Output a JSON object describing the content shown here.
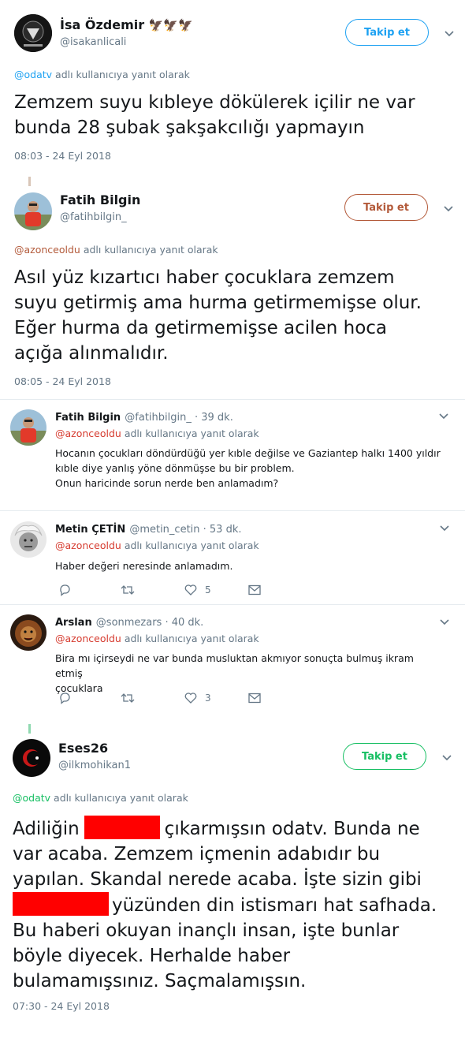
{
  "tweet1": {
    "name": "İsa Özdemir",
    "flags": "🦅🦅🦅",
    "handle": "@isakanlicali",
    "follow_label": "Takip et",
    "reply_to": "@odatv",
    "reply_suffix": "adlı kullanıcıya yanıt olarak",
    "text": "Zemzem suyu kıbleye dökülerek içilir ne var bunda 28 şubak şakşakcılığı yapmayın",
    "time": "08:03 - 24 Eyl 2018"
  },
  "tweet2": {
    "name": "Fatih Bilgin",
    "handle": "@fatihbilgin_",
    "follow_label": "Takip et",
    "reply_to": "@azonceoldu",
    "reply_suffix": "adlı kullanıcıya yanıt olarak",
    "text": "Asıl yüz kızartıcı haber çocuklara zemzem suyu getirmiş ama hurma getirmemişse olur. Eğer hurma da getirmemişse acilen hoca açığa alınmalıdır.",
    "time": "08:05 - 24 Eyl 2018"
  },
  "replies": [
    {
      "name": "Fatih Bilgin",
      "handle": "@fatihbilgin_ · 39 dk.",
      "reply_to": "@azonceoldu",
      "reply_suffix": "adlı kullanıcıya yanıt olarak",
      "line1": "Hocanın çocukları döndürdüğü yer kıble değilse ve Gaziantep halkı 1400 yıldır",
      "line2": "kıble diye yanlış yöne dönmüşse bu bir problem.",
      "line3": "Onun haricinde sorun nerde ben anlamadım?"
    },
    {
      "name": "Metin ÇETİN",
      "handle": "@metin_cetin · 53 dk.",
      "reply_to": "@azonceoldu",
      "reply_suffix": "adlı kullanıcıya yanıt olarak",
      "line1": "Haber değeri  neresinde anlamadım.",
      "likes": "5"
    },
    {
      "name": "Arslan",
      "handle": "@sonmezars · 40 dk.",
      "reply_to": "@azonceoldu",
      "reply_suffix": "adlı kullanıcıya yanıt olarak",
      "line1": "Bira mı içirseydi ne var bunda musluktan akmıyor sonuçta bulmuş ikram etmiş",
      "line2": "çocuklara",
      "likes": "3"
    }
  ],
  "tweet3": {
    "name": "Eses26",
    "handle": "@ilkmohikan1",
    "follow_label": "Takip et",
    "reply_to": "@odatv",
    "reply_suffix": "adlı kullanıcıya yanıt olarak",
    "l1a": "Adiliğin",
    "l1b": "çıkarmışsın odatv. Bunda ne",
    "l2": "var acaba. Zemzem içmenin adabıdır bu",
    "l3": "yapılan. Skandal nerede acaba. İşte sizin gibi",
    "l4b": "yüzünden din istismarı hat safhada.",
    "l5": "Bu haberi okuyan inançlı insan, işte bunlar",
    "l6": "böyle diyecek. Herhalde haber",
    "l7": "bulamamışsınız. Saçmalamışsın.",
    "time": "07:30 - 24 Eyl 2018"
  },
  "colors": {
    "blue": "#1da1f2",
    "brown": "#b35a3a",
    "green": "#17bf63",
    "gray": "#657786",
    "redact": "#ff0000"
  }
}
